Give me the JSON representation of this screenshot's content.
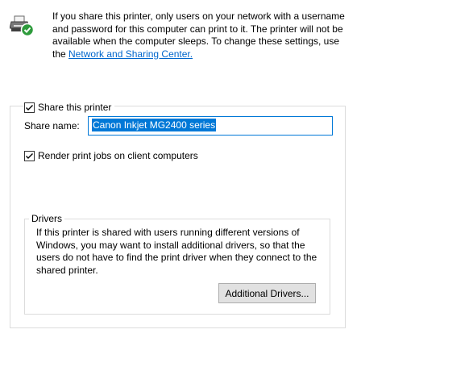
{
  "info": {
    "icon": "shared-printer-icon",
    "text": "If you share this printer, only users on your network with a username and password for this computer can print to it. The printer will not be available when the computer sleeps. To change these settings, use the ",
    "link_label": "Network and Sharing Center."
  },
  "share": {
    "checkbox_label": "Share this printer",
    "checked": true,
    "name_label": "Share name:",
    "name_value": "Canon Inkjet MG2400 series"
  },
  "render": {
    "checkbox_label": "Render print jobs on client computers",
    "checked": true
  },
  "drivers": {
    "title": "Drivers",
    "text": "If this printer is shared with users running different versions of Windows, you may want to install additional drivers, so that the users do not have to find the print driver when they connect to the shared printer.",
    "button_label": "Additional Drivers..."
  },
  "colors": {
    "accent": "#0078d7",
    "link": "#0066cc",
    "check_badge": "#2e9b3c"
  }
}
